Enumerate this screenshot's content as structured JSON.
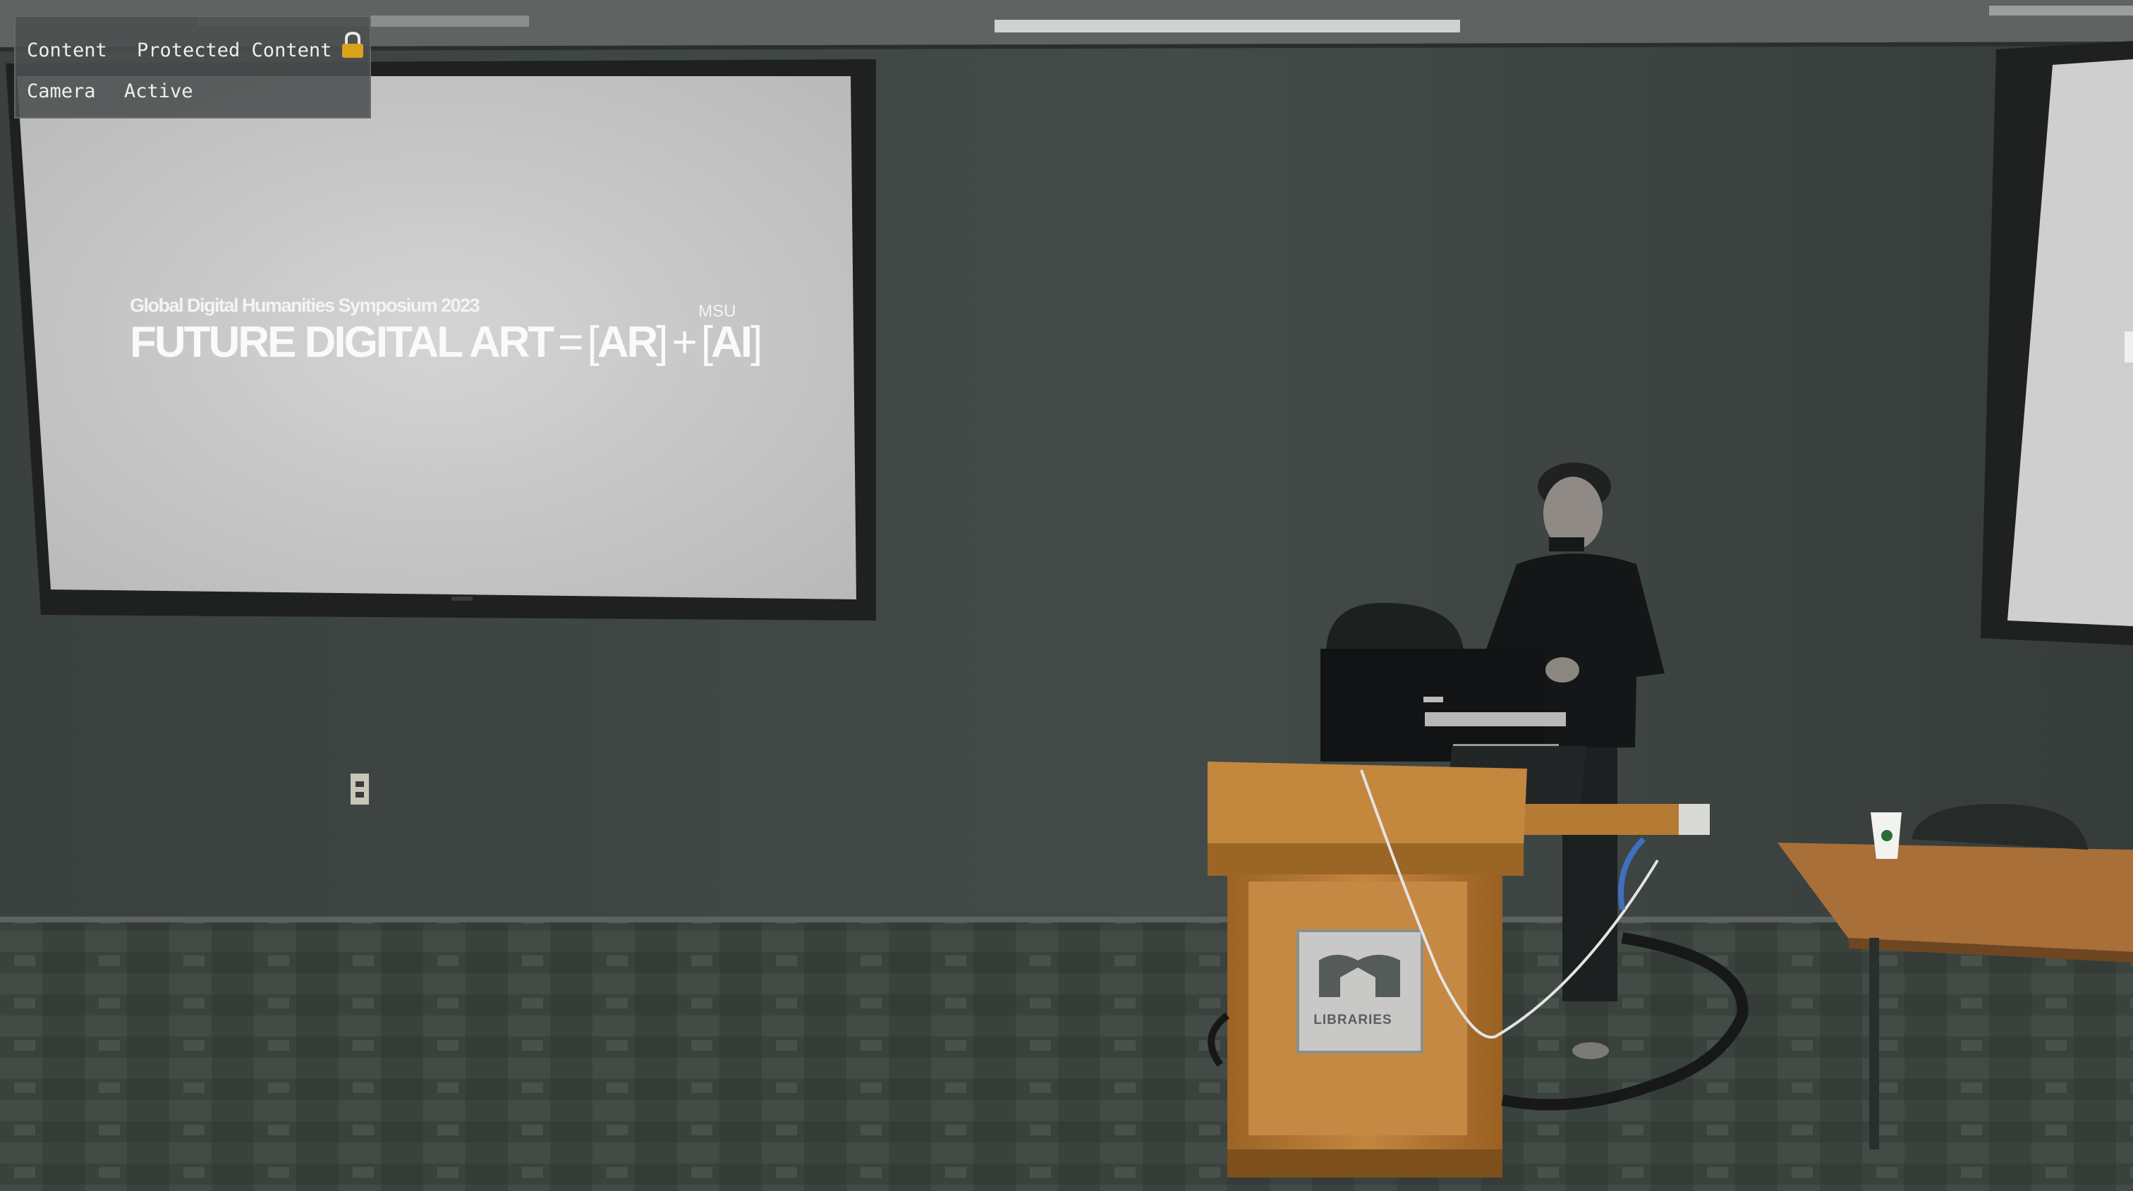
{
  "overlay": {
    "content_label": "Content",
    "content_value": "Protected Content",
    "camera_label": "Camera",
    "camera_value": "Active",
    "lock_icon": "lock-icon"
  },
  "slide": {
    "subtitle": "Global Digital Humanities Symposium 2023",
    "corner_label": "MSU",
    "title_main": "FUTURE DIGITAL ART",
    "equals": "=",
    "term_a": "AR",
    "plus": "+",
    "term_b": "AI"
  },
  "podium": {
    "plaque_text": "LIBRARIES"
  },
  "colors": {
    "wall": "#3b4240",
    "screen": "#c9c9c9",
    "podium_wood": "#b57a33",
    "carpet": "#3d4540"
  }
}
